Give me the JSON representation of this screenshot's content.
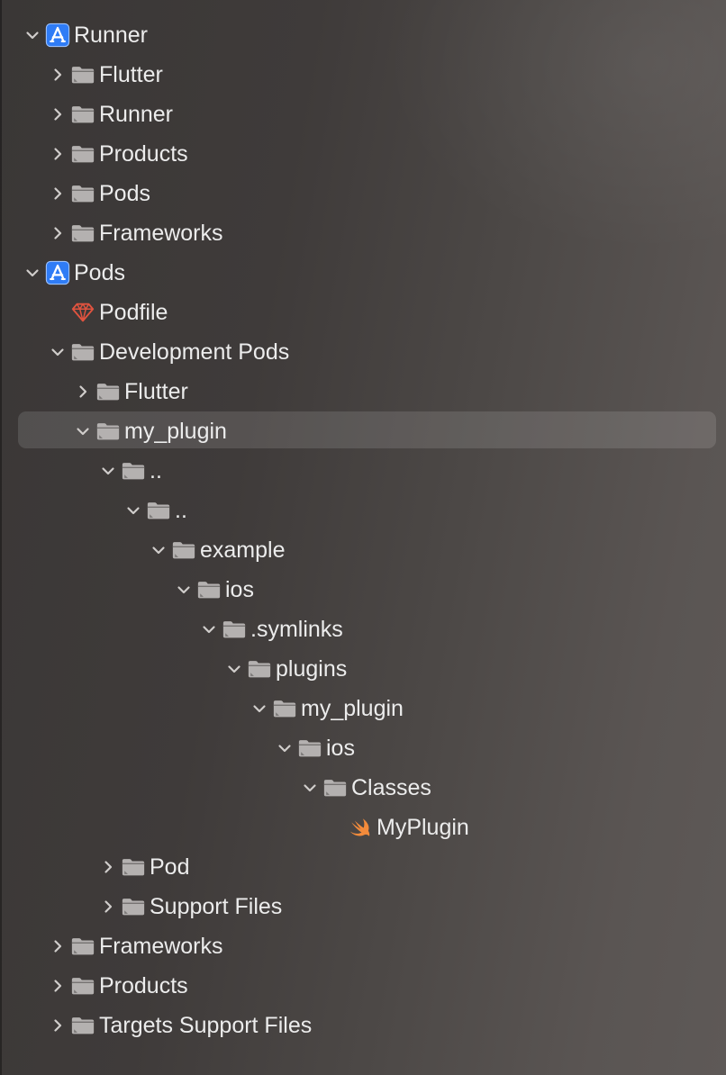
{
  "navigator": {
    "items": [
      {
        "label": "Runner",
        "depth": 0,
        "expanded": true,
        "icon": "xcode-project-icon"
      },
      {
        "label": "Flutter",
        "depth": 1,
        "expanded": false,
        "icon": "folder-icon"
      },
      {
        "label": "Runner",
        "depth": 1,
        "expanded": false,
        "icon": "folder-icon"
      },
      {
        "label": "Products",
        "depth": 1,
        "expanded": false,
        "icon": "folder-icon"
      },
      {
        "label": "Pods",
        "depth": 1,
        "expanded": false,
        "icon": "folder-icon"
      },
      {
        "label": "Frameworks",
        "depth": 1,
        "expanded": false,
        "icon": "folder-icon"
      },
      {
        "label": "Pods",
        "depth": 0,
        "expanded": true,
        "icon": "xcode-project-icon"
      },
      {
        "label": "Podfile",
        "depth": 1,
        "expanded": null,
        "icon": "ruby-gem-icon"
      },
      {
        "label": "Development Pods",
        "depth": 1,
        "expanded": true,
        "icon": "folder-icon"
      },
      {
        "label": "Flutter",
        "depth": 2,
        "expanded": false,
        "icon": "folder-icon"
      },
      {
        "label": "my_plugin",
        "depth": 2,
        "expanded": true,
        "icon": "folder-icon",
        "selected": true
      },
      {
        "label": "..",
        "depth": 3,
        "expanded": true,
        "icon": "folder-icon"
      },
      {
        "label": "..",
        "depth": 4,
        "expanded": true,
        "icon": "folder-icon"
      },
      {
        "label": "example",
        "depth": 5,
        "expanded": true,
        "icon": "folder-icon"
      },
      {
        "label": "ios",
        "depth": 6,
        "expanded": true,
        "icon": "folder-icon"
      },
      {
        "label": ".symlinks",
        "depth": 7,
        "expanded": true,
        "icon": "folder-icon"
      },
      {
        "label": "plugins",
        "depth": 8,
        "expanded": true,
        "icon": "folder-icon"
      },
      {
        "label": "my_plugin",
        "depth": 9,
        "expanded": true,
        "icon": "folder-icon"
      },
      {
        "label": "ios",
        "depth": 10,
        "expanded": true,
        "icon": "folder-icon"
      },
      {
        "label": "Classes",
        "depth": 11,
        "expanded": true,
        "icon": "folder-icon"
      },
      {
        "label": "MyPlugin",
        "depth": 12,
        "expanded": null,
        "icon": "swift-file-icon"
      },
      {
        "label": "Pod",
        "depth": 3,
        "expanded": false,
        "icon": "folder-icon"
      },
      {
        "label": "Support Files",
        "depth": 3,
        "expanded": false,
        "icon": "folder-icon"
      },
      {
        "label": "Frameworks",
        "depth": 1,
        "expanded": false,
        "icon": "folder-icon"
      },
      {
        "label": "Products",
        "depth": 1,
        "expanded": false,
        "icon": "folder-icon"
      },
      {
        "label": "Targets Support Files",
        "depth": 1,
        "expanded": false,
        "icon": "folder-icon"
      }
    ]
  },
  "colors": {
    "text": "#ececec",
    "chevron": "#d0cdcb",
    "folder": "#b4b1b0",
    "xcode_blue": "#2f7cf6",
    "ruby_red": "#e0533f",
    "swift_orange": "#f38b3b"
  }
}
